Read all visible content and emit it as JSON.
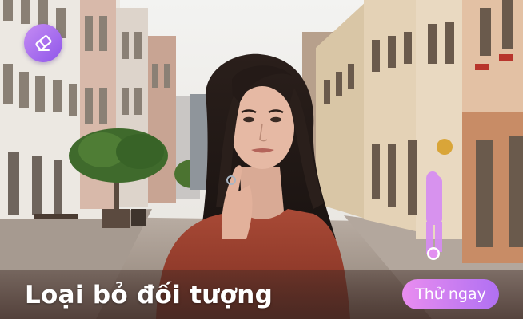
{
  "banner": {
    "headline": "Loại bỏ đối tượng",
    "cta_label": "Thử ngay"
  },
  "icons": {
    "badge_icon": "eraser-icon",
    "selection_marker": "pink-selection-marker"
  },
  "colors": {
    "accent_start": "#e98df0",
    "accent_end": "#b070f2",
    "badge_start": "#c58cf3",
    "badge_end": "#8f56ea",
    "selection_highlight": "#d68cf2"
  }
}
